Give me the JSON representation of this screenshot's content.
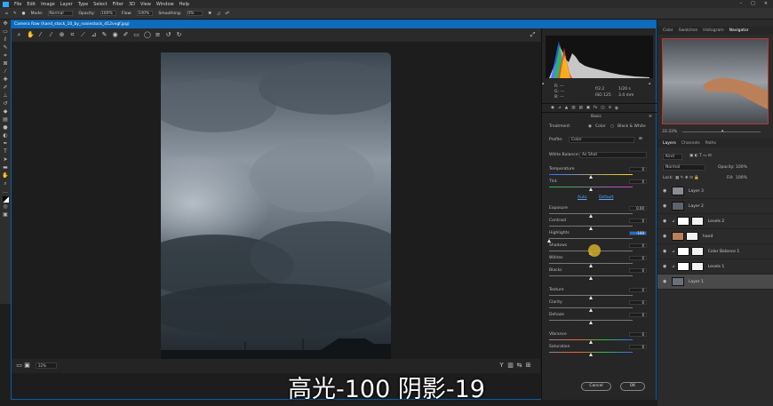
{
  "menubar": {
    "items": [
      "File",
      "Edit",
      "Image",
      "Layer",
      "Type",
      "Select",
      "Filter",
      "3D",
      "View",
      "Window",
      "Help"
    ]
  },
  "optbar": {
    "mode_label": "Mode:",
    "mode_value": "Normal",
    "opacity_label": "Opacity:",
    "opacity_value": "100%",
    "flow_label": "Flow:",
    "flow_value": "100%",
    "smoothing_label": "Smoothing:",
    "smoothing_value": "0%"
  },
  "acr": {
    "title": "Camera Raw (hand_stock_10_by_nosiestock_d12vvgf.jpg)",
    "zoom": "22%",
    "histogram_readout": {
      "r": "R: ---",
      "g": "G: ---",
      "b": "B: ---",
      "aperture": "f/2.2",
      "shutter": "1/20 s",
      "iso": "ISO 125",
      "focal": "3.4 mm"
    },
    "panel_title": "Basic",
    "treatment_label": "Treatment:",
    "treatment_color": "Color",
    "treatment_bw": "Black & White",
    "profile_label": "Profile:",
    "profile_value": "Color",
    "wb_label": "White Balance:",
    "wb_value": "As Shot",
    "auto_label": "Auto",
    "default_label": "Default",
    "sliders": [
      {
        "label": "Temperature",
        "value": "0",
        "pos": 0.5
      },
      {
        "label": "Tint",
        "value": "0",
        "pos": 0.5
      },
      {
        "label": "Exposure",
        "value": "0.00",
        "pos": 0.5
      },
      {
        "label": "Contrast",
        "value": "0",
        "pos": 0.5
      },
      {
        "label": "Highlights",
        "value": "-100",
        "pos": 0.0
      },
      {
        "label": "Shadows",
        "value": "0",
        "pos": 0.5
      },
      {
        "label": "Whites",
        "value": "0",
        "pos": 0.5
      },
      {
        "label": "Blacks",
        "value": "0",
        "pos": 0.5
      },
      {
        "label": "Texture",
        "value": "0",
        "pos": 0.5
      },
      {
        "label": "Clarity",
        "value": "0",
        "pos": 0.5
      },
      {
        "label": "Dehaze",
        "value": "0",
        "pos": 0.5
      },
      {
        "label": "Vibrance",
        "value": "0",
        "pos": 0.5
      },
      {
        "label": "Saturation",
        "value": "0",
        "pos": 0.5
      }
    ],
    "cancel_label": "Cancel",
    "ok_label": "OK"
  },
  "subtitle": "高光-100 阴影-19",
  "rightpanel": {
    "tabs": [
      "Color",
      "Swatches",
      "Histogram",
      "Navigator"
    ],
    "nav_zoom": "33.33%",
    "layer_tabs": [
      "Layers",
      "Channels",
      "Paths"
    ],
    "kind_label": "Kind",
    "blend_value": "Normal",
    "opacity_label": "Opacity:",
    "opacity_value": "100%",
    "lock_label": "Lock:",
    "fill_label": "Fill:",
    "fill_value": "100%",
    "layers": [
      {
        "name": "Layer 3"
      },
      {
        "name": "Layer 2"
      },
      {
        "name": "Levels 2"
      },
      {
        "name": "hand"
      },
      {
        "name": "Color Balance 1"
      },
      {
        "name": "Levels 1"
      },
      {
        "name": "Layer 1"
      }
    ]
  },
  "colors": {
    "accent": "#0f6cbd",
    "highlight_value_bg": "#1f6fd0",
    "cursor": "#c9a52a"
  }
}
